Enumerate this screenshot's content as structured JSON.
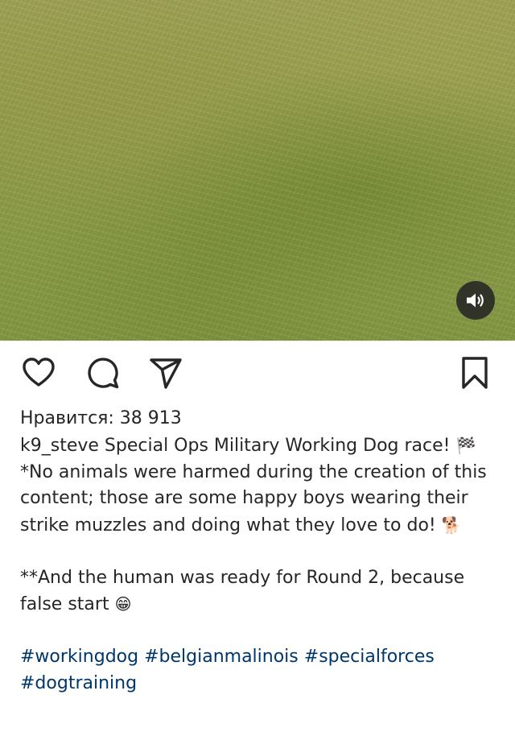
{
  "post": {
    "likes_label": "Нравится: 38 913",
    "username": "k9_steve",
    "caption_line1_text": "Special Ops Military Working Dog race!",
    "caption_line1_emoji": "🏁",
    "caption_para1": "*No animals were harmed during the creation of this content; those are some happy boys wearing their strike muzzles and doing what they love to do!",
    "caption_para1_emoji": "🐕",
    "caption_para2": "**And the human was ready for Round 2, because false start",
    "caption_para2_emoji": "😁",
    "hashtags": [
      "#workingdog",
      "#belgianmalinois",
      "#specialforces",
      "#dogtraining"
    ]
  },
  "icons": {
    "sound": "speaker-icon",
    "like": "heart-icon",
    "comment": "comment-bubble-icon",
    "share": "paper-plane-icon",
    "save": "bookmark-icon"
  },
  "colors": {
    "text": "#262626",
    "hashtag": "#00376b",
    "sound_button_bg": "#262626"
  }
}
